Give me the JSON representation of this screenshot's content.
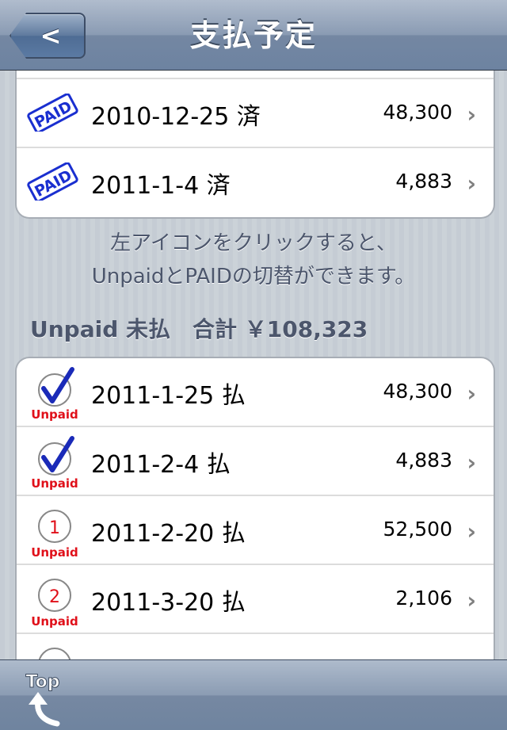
{
  "navbar": {
    "title": "支払予定",
    "back_label": "<"
  },
  "paid_section": {
    "rows": [
      {
        "date": "2010-12-25 済",
        "amount": "48,300",
        "stamp": "PAID"
      },
      {
        "date": "2011-1-4 済",
        "amount": "4,883",
        "stamp": "PAID"
      }
    ]
  },
  "info": {
    "line1": "左アイコンをクリックすると、",
    "line2": "UnpaidとPAIDの切替ができます。"
  },
  "unpaid_section": {
    "header": "Unpaid 未払　合計 ￥108,323",
    "rows": [
      {
        "date": "2011-1-25 払",
        "amount": "48,300",
        "icon": "check-icon",
        "badge": "Unpaid"
      },
      {
        "date": "2011-2-4 払",
        "amount": "4,883",
        "icon": "check-icon",
        "badge": "Unpaid"
      },
      {
        "date": "2011-2-20 払",
        "amount": "52,500",
        "icon": "circle-number-icon",
        "number": "1",
        "badge": "Unpaid"
      },
      {
        "date": "2011-3-20 払",
        "amount": "2,106",
        "icon": "circle-number-icon",
        "number": "2",
        "badge": "Unpaid"
      }
    ]
  },
  "toolbar": {
    "top_label": "Top"
  },
  "colors": {
    "unpaid_red": "#e0101a",
    "paid_blue": "#1a2fd0",
    "check_blue": "#1a2ab8"
  }
}
